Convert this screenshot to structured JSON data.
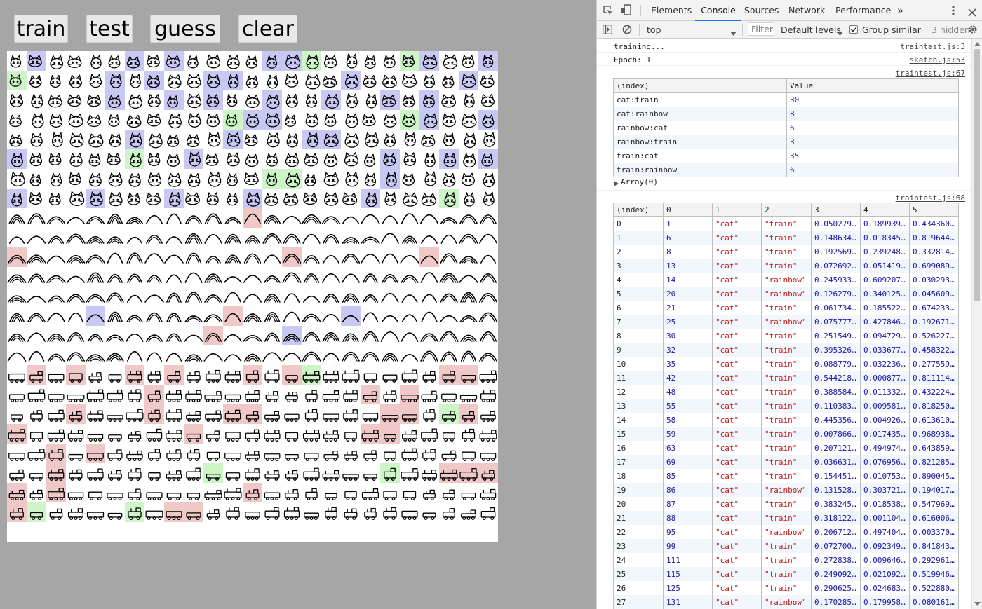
{
  "app": {
    "buttons": [
      {
        "id": "train",
        "label": "train"
      },
      {
        "id": "test",
        "label": "test"
      },
      {
        "id": "guess",
        "label": "guess"
      },
      {
        "id": "clear",
        "label": "clear"
      }
    ],
    "grid": {
      "columns": 25,
      "row_categories": [
        "cat",
        "cat",
        "cat",
        "cat",
        "cat",
        "cat",
        "cat",
        "cat",
        "rainbow",
        "rainbow",
        "rainbow",
        "rainbow",
        "rainbow",
        "rainbow",
        "rainbow",
        "rainbow",
        "train",
        "train",
        "train",
        "train",
        "train",
        "train",
        "train",
        "train"
      ],
      "highlight_colors": {
        "blue": "#c8c8f5",
        "green": "#cdf5c8",
        "red": "#f0c8c8"
      },
      "highlights": {
        "0": {
          "1": "blue",
          "6": "blue",
          "8": "blue",
          "13": "blue",
          "14": "blue",
          "15": "green",
          "20": "green",
          "21": "blue",
          "24": "blue"
        },
        "1": {
          "0": "green",
          "5": "blue",
          "7": "blue",
          "10": "blue",
          "11": "blue",
          "17": "blue",
          "23": "blue"
        },
        "2": {
          "5": "blue",
          "8": "blue",
          "10": "blue",
          "13": "blue",
          "16": "blue",
          "19": "blue",
          "21": "blue"
        },
        "3": {
          "11": "green",
          "12": "blue",
          "13": "blue",
          "20": "green",
          "21": "blue",
          "24": "blue"
        },
        "4": {
          "6": "blue",
          "11": "blue",
          "15": "blue",
          "16": "blue"
        },
        "5": {
          "0": "blue",
          "6": "green",
          "9": "blue",
          "19": "blue",
          "22": "blue",
          "24": "blue"
        },
        "6": {
          "13": "green",
          "14": "green",
          "19": "blue"
        },
        "7": {
          "0": "blue",
          "4": "blue",
          "8": "blue",
          "12": "blue",
          "18": "blue",
          "22": "green"
        },
        "8": {
          "12": "red"
        },
        "10": {
          "0": "red",
          "14": "red",
          "21": "red"
        },
        "13": {
          "4": "blue",
          "11": "red",
          "17": "blue"
        },
        "14": {
          "10": "red",
          "14": "blue"
        },
        "16": {
          "1": "red",
          "3": "red",
          "6": "red",
          "8": "red",
          "12": "red",
          "14": "red",
          "15": "green",
          "22": "red",
          "23": "red"
        },
        "17": {
          "7": "red",
          "18": "red",
          "20": "red"
        },
        "18": {
          "3": "red",
          "7": "red",
          "11": "red",
          "12": "red",
          "19": "red",
          "20": "red",
          "22": "green",
          "23": "red"
        },
        "19": {
          "0": "red",
          "9": "red",
          "18": "red",
          "19": "red"
        },
        "20": {
          "2": "red",
          "4": "red"
        },
        "21": {
          "2": "red",
          "10": "green",
          "19": "green",
          "22": "red",
          "23": "red",
          "24": "red"
        },
        "22": {
          "0": "red",
          "2": "red",
          "12": "red"
        },
        "23": {
          "0": "red",
          "1": "green",
          "6": "green",
          "8": "red",
          "9": "red"
        }
      }
    }
  },
  "devtools": {
    "tabs": [
      "Elements",
      "Console",
      "Sources",
      "Network",
      "Performance"
    ],
    "active_tab": "Console",
    "more_tabs": "»",
    "toolbar": {
      "context": "top",
      "filter_placeholder": "Filter",
      "levels": "Default levels",
      "group_similar": "Group similar",
      "group_similar_checked": true,
      "hidden": "3 hidden"
    },
    "log1": {
      "text": "training...",
      "source": "traintest.js:3"
    },
    "log2": {
      "text": "Epoch: 1",
      "source": "sketch.js:53"
    },
    "table1": {
      "source": "traintest.js:67",
      "headers": [
        "(index)",
        "Value"
      ],
      "rows": [
        [
          "cat:train",
          "30"
        ],
        [
          "cat:rainbow",
          "8"
        ],
        [
          "rainbow:cat",
          "6"
        ],
        [
          "rainbow:train",
          "3"
        ],
        [
          "train:cat",
          "35"
        ],
        [
          "train:rainbow",
          "6"
        ]
      ],
      "footer": "Array(0)"
    },
    "table2": {
      "source": "traintest.js:68",
      "headers": [
        "(index)",
        "0",
        "1",
        "2",
        "3",
        "4",
        "5"
      ],
      "rows": [
        [
          "0",
          "1",
          "\"cat\"",
          "\"train\"",
          "0.050279…",
          "0.189939…",
          "0.434360…"
        ],
        [
          "1",
          "6",
          "\"cat\"",
          "\"train\"",
          "0.148634…",
          "0.018345…",
          "0.819644…"
        ],
        [
          "2",
          "8",
          "\"cat\"",
          "\"train\"",
          "0.192569…",
          "0.239248…",
          "0.332814…"
        ],
        [
          "3",
          "13",
          "\"cat\"",
          "\"train\"",
          "0.072692…",
          "0.051419…",
          "0.699089…"
        ],
        [
          "4",
          "14",
          "\"cat\"",
          "\"rainbow\"",
          "0.245933…",
          "0.609207…",
          "0.030293…"
        ],
        [
          "5",
          "20",
          "\"cat\"",
          "\"rainbow\"",
          "0.126279…",
          "0.340125…",
          "0.045609…"
        ],
        [
          "6",
          "21",
          "\"cat\"",
          "\"train\"",
          "0.061734…",
          "0.185522…",
          "0.674233…"
        ],
        [
          "7",
          "25",
          "\"cat\"",
          "\"rainbow\"",
          "0.075777…",
          "0.427846…",
          "0.192671…"
        ],
        [
          "8",
          "30",
          "\"cat\"",
          "\"train\"",
          "0.251549…",
          "0.094729…",
          "0.526227…"
        ],
        [
          "9",
          "32",
          "\"cat\"",
          "\"train\"",
          "0.395326…",
          "0.033677…",
          "0.458322…"
        ],
        [
          "10",
          "35",
          "\"cat\"",
          "\"train\"",
          "0.088779…",
          "0.032236…",
          "0.277559…"
        ],
        [
          "11",
          "42",
          "\"cat\"",
          "\"train\"",
          "0.544218…",
          "0.000877…",
          "0.811114…"
        ],
        [
          "12",
          "48",
          "\"cat\"",
          "\"train\"",
          "0.388584…",
          "0.011332…",
          "0.432224…"
        ],
        [
          "13",
          "55",
          "\"cat\"",
          "\"train\"",
          "0.110383…",
          "0.009581…",
          "0.818250…"
        ],
        [
          "14",
          "58",
          "\"cat\"",
          "\"train\"",
          "0.445356…",
          "0.004926…",
          "0.613610…"
        ],
        [
          "15",
          "59",
          "\"cat\"",
          "\"train\"",
          "0.007866…",
          "0.017435…",
          "0.968938…"
        ],
        [
          "16",
          "63",
          "\"cat\"",
          "\"train\"",
          "0.207121…",
          "0.494974…",
          "0.643859…"
        ],
        [
          "17",
          "69",
          "\"cat\"",
          "\"train\"",
          "0.036631…",
          "0.076956…",
          "0.821285…"
        ],
        [
          "18",
          "85",
          "\"cat\"",
          "\"train\"",
          "0.154451…",
          "0.010753…",
          "0.890045…"
        ],
        [
          "19",
          "86",
          "\"cat\"",
          "\"rainbow\"",
          "0.131528…",
          "0.303721…",
          "0.194017…"
        ],
        [
          "20",
          "87",
          "\"cat\"",
          "\"train\"",
          "0.383245…",
          "0.018538…",
          "0.547969…"
        ],
        [
          "21",
          "88",
          "\"cat\"",
          "\"train\"",
          "0.318122…",
          "0.001104…",
          "0.616006…"
        ],
        [
          "22",
          "95",
          "\"cat\"",
          "\"rainbow\"",
          "0.206712…",
          "0.497404…",
          "0.003370…"
        ],
        [
          "23",
          "99",
          "\"cat\"",
          "\"train\"",
          "0.072700…",
          "0.092349…",
          "0.841843…"
        ],
        [
          "24",
          "111",
          "\"cat\"",
          "\"train\"",
          "0.272838…",
          "0.009646…",
          "0.292961…"
        ],
        [
          "25",
          "115",
          "\"cat\"",
          "\"train\"",
          "0.249092…",
          "0.021092…",
          "0.519946…"
        ],
        [
          "26",
          "125",
          "\"cat\"",
          "\"train\"",
          "0.290625…",
          "0.024683…",
          "0.522880…"
        ],
        [
          "27",
          "131",
          "\"cat\"",
          "\"rainbow\"",
          "0.170285…",
          "0.179958…",
          "0.080161…"
        ]
      ]
    }
  }
}
